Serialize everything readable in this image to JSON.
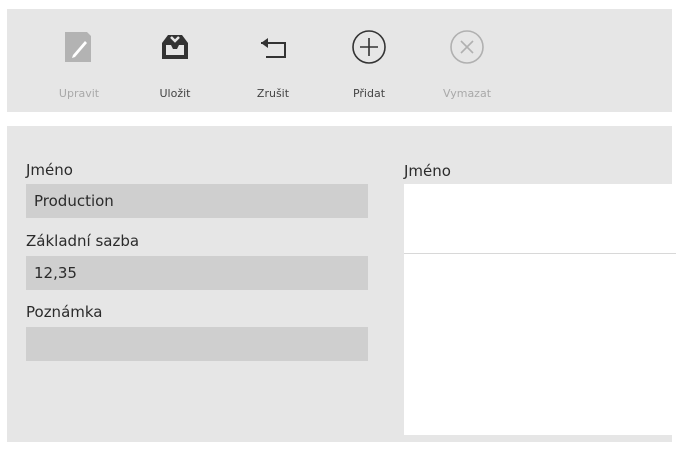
{
  "toolbar": {
    "buttons": [
      {
        "label": "Upravit",
        "icon": "edit-icon",
        "enabled": false
      },
      {
        "label": "Uložit",
        "icon": "save-tray-icon",
        "enabled": true
      },
      {
        "label": "Zrušit",
        "icon": "undo-arrow-icon",
        "enabled": true
      },
      {
        "label": "Přidat",
        "icon": "plus-circle-icon",
        "enabled": true
      },
      {
        "label": "Vymazat",
        "icon": "delete-circle-icon",
        "enabled": false
      }
    ]
  },
  "form": {
    "name_label": "Jméno",
    "name_value": "Production",
    "rate_label": "Základní sazba",
    "rate_value": "12,35",
    "note_label": "Poznámka",
    "note_value": ""
  },
  "list": {
    "header": "Jméno",
    "items": [
      ""
    ]
  },
  "colors": {
    "panel_bg": "#e6e6e6",
    "input_bg": "#cfcfcf",
    "enabled_icon": "#333333",
    "disabled_icon": "#b0b0b0"
  }
}
